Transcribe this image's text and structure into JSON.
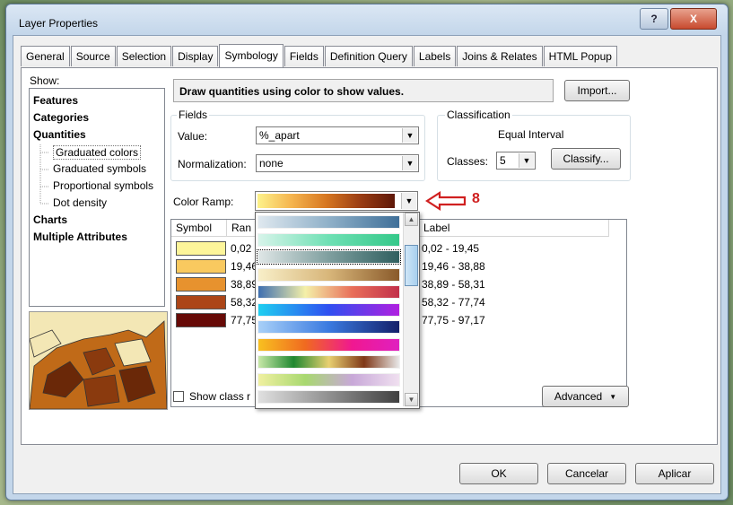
{
  "window": {
    "title": "Layer Properties",
    "help_glyph": "?",
    "close_glyph": "X"
  },
  "tabs": [
    "General",
    "Source",
    "Selection",
    "Display",
    "Symbology",
    "Fields",
    "Definition Query",
    "Labels",
    "Joins & Relates",
    "HTML Popup"
  ],
  "active_tab": "Symbology",
  "show": {
    "label": "Show:",
    "items": [
      "Features",
      "Categories",
      "Quantities",
      "Graduated colors",
      "Graduated symbols",
      "Proportional symbols",
      "Dot density",
      "Charts",
      "Multiple Attributes"
    ]
  },
  "description": "Draw quantities using color to show values.",
  "import_label": "Import...",
  "fields": {
    "group_label": "Fields",
    "value_label": "Value:",
    "value": "%_apart",
    "normalization_label": "Normalization:",
    "normalization": "none"
  },
  "classification": {
    "group_label": "Classification",
    "method": "Equal Interval",
    "classes_label": "Classes:",
    "classes": "5",
    "classify_label": "Classify..."
  },
  "color_ramp_label": "Color Ramp:",
  "annotation": "8",
  "table": {
    "headers": {
      "symbol": "Symbol",
      "range": "Ran",
      "label": "Label"
    },
    "rows": [
      {
        "color": "#fdf59a",
        "range": "0,02",
        "label": "0,02 - 19,45"
      },
      {
        "color": "#f9c95f",
        "range": "19,46",
        "label": "19,46 - 38,88"
      },
      {
        "color": "#e7922e",
        "range": "38,89",
        "label": "38,89 - 58,31"
      },
      {
        "color": "#ac4517",
        "range": "58,32",
        "label": "58,32 - 77,74"
      },
      {
        "color": "#670a07",
        "range": "77,75",
        "label": "77,75 - 97,17"
      }
    ]
  },
  "show_class_label": "Show class r",
  "advanced_label": "Advanced",
  "buttons": {
    "ok": "OK",
    "cancel": "Cancelar",
    "apply": "Aplicar"
  },
  "ramps": [
    {
      "name": "blue-gray",
      "gradient": "linear-gradient(to right,#dfe8ef,#8fb0c8,#3f6f98)"
    },
    {
      "name": "aqua-green",
      "gradient": "linear-gradient(to right,#d7f4ea,#6ee0b4,#34c889)"
    },
    {
      "name": "gray-teal",
      "gradient": "linear-gradient(to right,#dfe6e6,#7f9f9f,#2f5f5f)"
    },
    {
      "name": "cream-brown",
      "gradient": "linear-gradient(to right,#f8efc8,#d8b67a,#8a5a2a)"
    },
    {
      "name": "blue-yellow-red",
      "gradient": "linear-gradient(to right,#3f6fb0,#f4f0a8,#e86f5a,#c2304a)"
    },
    {
      "name": "cyan-blue-magenta",
      "gradient": "linear-gradient(to right,#1fcff0,#2f4ff0,#b020e0)"
    },
    {
      "name": "blue-navy",
      "gradient": "linear-gradient(to right,#a8d0f8,#3a7ae0,#14206a)"
    },
    {
      "name": "orange-magenta",
      "gradient": "linear-gradient(to right,#f8c020,#f06a20,#f01890,#e020c0)"
    },
    {
      "name": "green-brown",
      "gradient": "linear-gradient(to right,#c8e8a8,#208830,#e8d070,#803818,#e8e8e8)"
    },
    {
      "name": "yellow-green-purple",
      "gradient": "linear-gradient(to right,#f0f0a0,#a8d870,#c8a8d8,#f0e0f0)"
    },
    {
      "name": "gray-black",
      "gradient": "linear-gradient(to right,#e0e0e0,#909090,#404040)"
    }
  ],
  "map_colors": [
    "#8a3a0e",
    "#6a2808",
    "#c06a18",
    "#f3e7b5"
  ]
}
